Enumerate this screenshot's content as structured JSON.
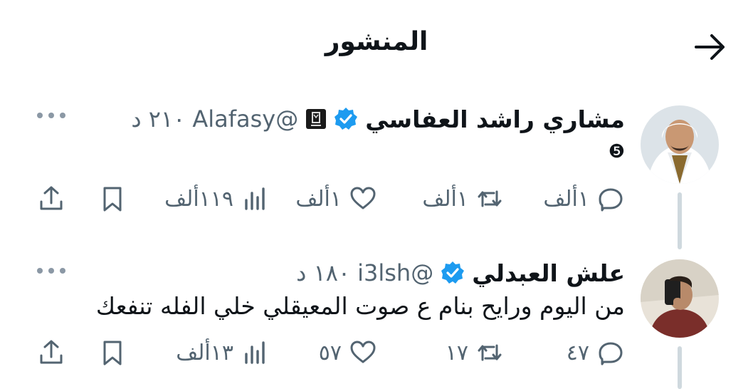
{
  "header": {
    "title": "المنشور",
    "back_icon": "arrow-right-icon"
  },
  "posts": [
    {
      "author_name": "مشاري راشد العفاسي",
      "handle": "@Alafasy",
      "time": "٢١٠ د",
      "text": "❺",
      "verified": true,
      "affiliate_badge": true,
      "stats": {
        "replies": "١ألف",
        "reposts": "١ألف",
        "likes": "١ألف",
        "views": "١١٩ألف"
      }
    },
    {
      "author_name": "علش العبدلي",
      "handle": "@i3lsh",
      "time": "١٨٠ د",
      "text": "من اليوم ورايح بنام ع صوت المعيقلي خلي الفله تنفعك",
      "verified": true,
      "affiliate_badge": false,
      "stats": {
        "replies": "٤٧",
        "reposts": "١٧",
        "likes": "٥٧",
        "views": "١٣ألف"
      }
    }
  ],
  "colors": {
    "text": "#0f1419",
    "muted": "#536471",
    "verified": "#1d9bf0",
    "thread_line": "#cfd9de"
  }
}
